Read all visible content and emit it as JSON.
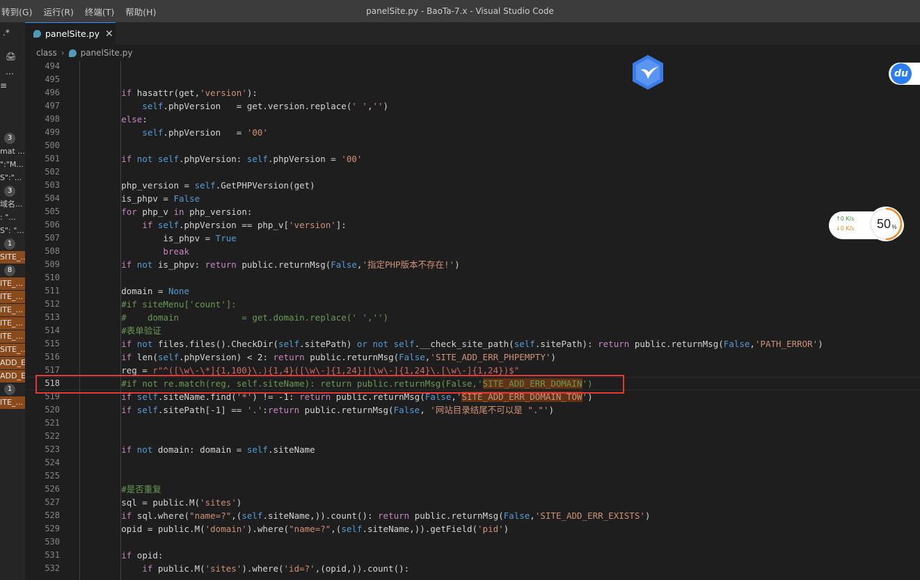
{
  "menu": [
    "转到(G)",
    "运行(R)",
    "终端(T)",
    "帮助(H)"
  ],
  "window_title": "panelSite.py - BaoTa-7.x - Visual Studio Code",
  "tab": {
    "label": "panelSite.py",
    "close": "✕"
  },
  "breadcrumb": [
    "class",
    "panelSite.py"
  ],
  "activity": {
    "icons": [
      ".*",
      "🖨",
      "…",
      "≡"
    ],
    "rows": [
      {
        "badge": "3"
      },
      {
        "text": "mat ..."
      },
      {
        "text": "\":\"M..."
      },
      {
        "text": "S\":\"..."
      },
      {
        "badge": "3"
      },
      {
        "text": "域名..."
      },
      {
        "text": ": \"..."
      },
      {
        "text": "S\": \"..."
      },
      {
        "badge": "1"
      },
      {
        "text": "SITE_...",
        "hl": true
      },
      {
        "badge": "8"
      },
      {
        "text": "ITE_...",
        "hl": true
      },
      {
        "text": "ITE_...",
        "hl": true
      },
      {
        "text": "ITE_...",
        "hl": true
      },
      {
        "text": "ITE_...",
        "hl": true
      },
      {
        "text": "ITE_...",
        "hl": true
      },
      {
        "text": "SITE_...",
        "hl": true
      },
      {
        "text": "ADD_E...",
        "hl": true
      },
      {
        "text": "ADD_E...",
        "hl": true
      },
      {
        "badge": "1"
      },
      {
        "text": "ITE_...",
        "hl": true
      }
    ]
  },
  "widgets": {
    "du_label": "du",
    "net_up": "↑0  K/s",
    "net_down": "↓0  K/s",
    "gauge_value": "50",
    "gauge_unit": "%",
    "gauge_level": 0.5
  },
  "editor": {
    "current_line": 518,
    "lines": [
      {
        "n": "494",
        "t": []
      },
      {
        "n": "495",
        "t": []
      },
      {
        "n": "496",
        "t": [
          [
            "        ",
            ""
          ],
          [
            "if ",
            "kf"
          ],
          [
            "hasattr(get,",
            ""
          ],
          [
            "'version'",
            "s"
          ],
          [
            "):",
            ""
          ]
        ]
      },
      {
        "n": "497",
        "t": [
          [
            "            ",
            ""
          ],
          [
            "self",
            "k"
          ],
          [
            ".phpVersion   = get.version.replace(",
            ""
          ],
          [
            "' '",
            "s"
          ],
          [
            ",",
            ""
          ],
          [
            "''",
            "s"
          ],
          [
            ")",
            ""
          ]
        ]
      },
      {
        "n": "498",
        "t": [
          [
            "        ",
            ""
          ],
          [
            "else",
            "kf"
          ],
          [
            ":",
            ""
          ]
        ]
      },
      {
        "n": "499",
        "t": [
          [
            "            ",
            ""
          ],
          [
            "self",
            "k"
          ],
          [
            ".phpVersion   = ",
            ""
          ],
          [
            "'00'",
            "s"
          ]
        ]
      },
      {
        "n": "500",
        "t": []
      },
      {
        "n": "501",
        "t": [
          [
            "        ",
            ""
          ],
          [
            "if ",
            "kf"
          ],
          [
            "not ",
            "k"
          ],
          [
            "self",
            "k"
          ],
          [
            ".phpVersion: ",
            ""
          ],
          [
            "self",
            "k"
          ],
          [
            ".phpVersion = ",
            ""
          ],
          [
            "'00'",
            "s"
          ]
        ]
      },
      {
        "n": "502",
        "t": []
      },
      {
        "n": "503",
        "t": [
          [
            "        php_version = ",
            ""
          ],
          [
            "self",
            "k"
          ],
          [
            ".GetPHPVersion(get)",
            ""
          ]
        ]
      },
      {
        "n": "504",
        "t": [
          [
            "        is_phpv = ",
            ""
          ],
          [
            "False",
            "k"
          ]
        ]
      },
      {
        "n": "505",
        "t": [
          [
            "        ",
            ""
          ],
          [
            "for ",
            "kf"
          ],
          [
            "php_v ",
            ""
          ],
          [
            "in ",
            "kf"
          ],
          [
            "php_version:",
            ""
          ]
        ]
      },
      {
        "n": "506",
        "t": [
          [
            "            ",
            ""
          ],
          [
            "if ",
            "kf"
          ],
          [
            "self",
            "k"
          ],
          [
            ".phpVersion == php_v[",
            ""
          ],
          [
            "'version'",
            "s"
          ],
          [
            "]:",
            ""
          ]
        ]
      },
      {
        "n": "507",
        "t": [
          [
            "                is_phpv = ",
            ""
          ],
          [
            "True",
            "k"
          ]
        ]
      },
      {
        "n": "508",
        "t": [
          [
            "                ",
            ""
          ],
          [
            "break",
            "kf"
          ]
        ]
      },
      {
        "n": "509",
        "t": [
          [
            "        ",
            ""
          ],
          [
            "if ",
            "kf"
          ],
          [
            "not ",
            "k"
          ],
          [
            "is_phpv: ",
            ""
          ],
          [
            "return ",
            "kf"
          ],
          [
            "public.returnMsg(",
            ""
          ],
          [
            "False",
            "k"
          ],
          [
            ",",
            ""
          ],
          [
            "'指定PHP版本不存在!'",
            "s"
          ],
          [
            ")",
            ""
          ]
        ]
      },
      {
        "n": "510",
        "t": []
      },
      {
        "n": "511",
        "t": [
          [
            "        domain = ",
            ""
          ],
          [
            "None",
            "k"
          ]
        ]
      },
      {
        "n": "512",
        "t": [
          [
            "        ",
            ""
          ],
          [
            "#if siteMenu['count']:",
            "c"
          ]
        ]
      },
      {
        "n": "513",
        "t": [
          [
            "        ",
            ""
          ],
          [
            "#    domain            = get.domain.replace(' ','')",
            "c"
          ]
        ]
      },
      {
        "n": "514",
        "t": [
          [
            "        ",
            ""
          ],
          [
            "#表单验证",
            "c"
          ]
        ]
      },
      {
        "n": "515",
        "t": [
          [
            "        ",
            ""
          ],
          [
            "if ",
            "kf"
          ],
          [
            "not ",
            "k"
          ],
          [
            "files.files().CheckDir(",
            ""
          ],
          [
            "self",
            "k"
          ],
          [
            ".sitePath) ",
            ""
          ],
          [
            "or ",
            "k"
          ],
          [
            "not ",
            "k"
          ],
          [
            "self",
            "k"
          ],
          [
            ".__check_site_path(",
            ""
          ],
          [
            "self",
            "k"
          ],
          [
            ".sitePath): ",
            ""
          ],
          [
            "return ",
            "kf"
          ],
          [
            "public.returnMsg(",
            ""
          ],
          [
            "False",
            "k"
          ],
          [
            ",",
            ""
          ],
          [
            "'PATH_ERROR'",
            "s"
          ],
          [
            ")",
            ""
          ]
        ]
      },
      {
        "n": "516",
        "t": [
          [
            "        ",
            ""
          ],
          [
            "if ",
            "kf"
          ],
          [
            "len",
            ""
          ],
          [
            "(",
            ""
          ],
          [
            "self",
            "k"
          ],
          [
            ".phpVersion) < ",
            ""
          ],
          [
            "2",
            ""
          ],
          [
            ": ",
            ""
          ],
          [
            "return ",
            "kf"
          ],
          [
            "public.returnMsg(",
            ""
          ],
          [
            "False",
            "k"
          ],
          [
            ",",
            ""
          ],
          [
            "'SITE_ADD_ERR_PHPEMPTY'",
            "s"
          ],
          [
            ")",
            ""
          ]
        ]
      },
      {
        "n": "517",
        "t": [
          [
            "        reg = ",
            ""
          ],
          [
            "r\"^([\\w\\-\\*]{1,100}\\.){1,4}([\\w\\-]{1,24}|[\\w\\-]{1,24}\\.[\\w\\-]{1,24})$\"",
            "rx"
          ]
        ]
      },
      {
        "n": "518",
        "t": [
          [
            "        ",
            ""
          ],
          [
            "#if not re.match(reg, self.siteName): return public.returnMsg(False,'",
            "c"
          ],
          [
            "SITE_ADD_ERR_DOMAIN",
            "c hl-find"
          ],
          [
            "')",
            "c"
          ]
        ]
      },
      {
        "n": "519",
        "t": [
          [
            "        ",
            ""
          ],
          [
            "if ",
            "kf"
          ],
          [
            "self",
            "k"
          ],
          [
            ".siteName.find(",
            ""
          ],
          [
            "'*'",
            "s"
          ],
          [
            ") != -1: ",
            ""
          ],
          [
            "return ",
            "kf"
          ],
          [
            "public.returnMsg(",
            ""
          ],
          [
            "False",
            "k"
          ],
          [
            ",",
            ""
          ],
          [
            "'",
            "s"
          ],
          [
            "SITE_ADD_ERR_DOMAIN_TOW",
            "s hl-find"
          ],
          [
            "'",
            "s"
          ],
          [
            ")",
            ""
          ]
        ]
      },
      {
        "n": "520",
        "t": [
          [
            "        ",
            ""
          ],
          [
            "if ",
            "kf"
          ],
          [
            "self",
            "k"
          ],
          [
            ".sitePath[-1] == ",
            ""
          ],
          [
            "'.'",
            "s"
          ],
          [
            ":",
            ""
          ],
          [
            "return ",
            "kf"
          ],
          [
            "public.returnMsg(",
            ""
          ],
          [
            "False",
            "k"
          ],
          [
            ", ",
            ""
          ],
          [
            "'网站目录结尾不可以是 \".\"'",
            "s"
          ],
          [
            ")",
            ""
          ]
        ]
      },
      {
        "n": "521",
        "t": []
      },
      {
        "n": "522",
        "t": []
      },
      {
        "n": "523",
        "t": [
          [
            "        ",
            ""
          ],
          [
            "if ",
            "kf"
          ],
          [
            "not ",
            "k"
          ],
          [
            "domain: domain = ",
            ""
          ],
          [
            "self",
            "k"
          ],
          [
            ".siteName",
            ""
          ]
        ]
      },
      {
        "n": "524",
        "t": []
      },
      {
        "n": "525",
        "t": []
      },
      {
        "n": "526",
        "t": [
          [
            "        ",
            ""
          ],
          [
            "#是否重复",
            "c"
          ]
        ]
      },
      {
        "n": "527",
        "t": [
          [
            "        sql = public.M(",
            ""
          ],
          [
            "'sites'",
            "s"
          ],
          [
            ")",
            ""
          ]
        ]
      },
      {
        "n": "528",
        "t": [
          [
            "        ",
            ""
          ],
          [
            "if ",
            "kf"
          ],
          [
            "sql.where(",
            ""
          ],
          [
            "\"name=?\"",
            "s"
          ],
          [
            ",(",
            ""
          ],
          [
            "self",
            "k"
          ],
          [
            ".siteName,)).count(): ",
            ""
          ],
          [
            "return ",
            "kf"
          ],
          [
            "public.returnMsg(",
            ""
          ],
          [
            "False",
            "k"
          ],
          [
            ",",
            ""
          ],
          [
            "'SITE_ADD_ERR_EXISTS'",
            "s"
          ],
          [
            ")",
            ""
          ]
        ]
      },
      {
        "n": "529",
        "t": [
          [
            "        opid = public.M(",
            ""
          ],
          [
            "'domain'",
            "s"
          ],
          [
            ").where(",
            ""
          ],
          [
            "\"name=?\"",
            "s"
          ],
          [
            ",(",
            ""
          ],
          [
            "self",
            "k"
          ],
          [
            ".siteName,)).getField(",
            ""
          ],
          [
            "'pid'",
            "s"
          ],
          [
            ")",
            ""
          ]
        ]
      },
      {
        "n": "530",
        "t": []
      },
      {
        "n": "531",
        "t": [
          [
            "        ",
            ""
          ],
          [
            "if ",
            "kf"
          ],
          [
            "opid:",
            ""
          ]
        ]
      },
      {
        "n": "532",
        "t": [
          [
            "            ",
            ""
          ],
          [
            "if ",
            "kf"
          ],
          [
            "public.M(",
            ""
          ],
          [
            "'sites'",
            "s"
          ],
          [
            ").where(",
            ""
          ],
          [
            "'id=?'",
            "s"
          ],
          [
            ",(opid,)).count():",
            ""
          ]
        ]
      }
    ]
  }
}
